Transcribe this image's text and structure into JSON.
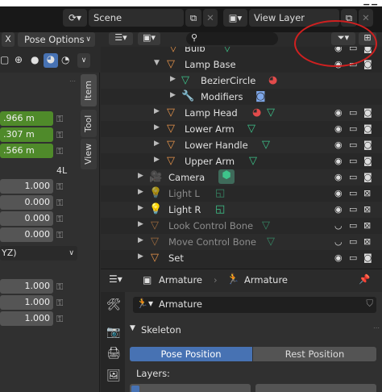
{
  "topbar": {
    "scene_label": "Scene",
    "view_layer_label": "View Layer"
  },
  "left_panel": {
    "close_label": "X",
    "pose_options_label": "Pose Options",
    "location_values": [
      ".966 m",
      ".307 m",
      ".566 m"
    ],
    "mode_label": "4L",
    "rotation_values": [
      "1.000",
      "0.000",
      "0.000",
      "0.000"
    ],
    "rotation_mode": "YZ)",
    "scale_values": [
      "1.000",
      "1.000",
      "1.000"
    ],
    "tabs": [
      "Item",
      "Tool",
      "View"
    ]
  },
  "outliner": {
    "search_placeholder": "",
    "rows": [
      {
        "label": "Bulb",
        "dim": false
      },
      {
        "label": "Lamp Base",
        "dim": false
      },
      {
        "label": "BezierCircle",
        "dim": false
      },
      {
        "label": "Modifiers",
        "dim": false
      },
      {
        "label": "Lamp Head",
        "dim": false
      },
      {
        "label": "Lower Arm",
        "dim": false
      },
      {
        "label": "Lower Handle",
        "dim": false
      },
      {
        "label": "Upper Arm",
        "dim": false
      },
      {
        "label": "Camera",
        "dim": false
      },
      {
        "label": "Light L",
        "dim": true
      },
      {
        "label": "Light R",
        "dim": false
      },
      {
        "label": "Look Control Bone",
        "dim": true
      },
      {
        "label": "Move Control Bone",
        "dim": true
      },
      {
        "label": "Set",
        "dim": false
      }
    ]
  },
  "properties": {
    "header_object_label": "Armature",
    "header_data_label": "Armature",
    "armature_field": "Armature",
    "section_title": "Skeleton",
    "pose_position_label": "Pose Position",
    "rest_position_label": "Rest Position",
    "layers_label": "Layers:"
  },
  "colors": {
    "accent": "#4772b3",
    "location_green": "#4f8a2a",
    "annotation_red": "#d02020",
    "bone_orange": "#e8954b",
    "data_green": "#3ec48b"
  }
}
